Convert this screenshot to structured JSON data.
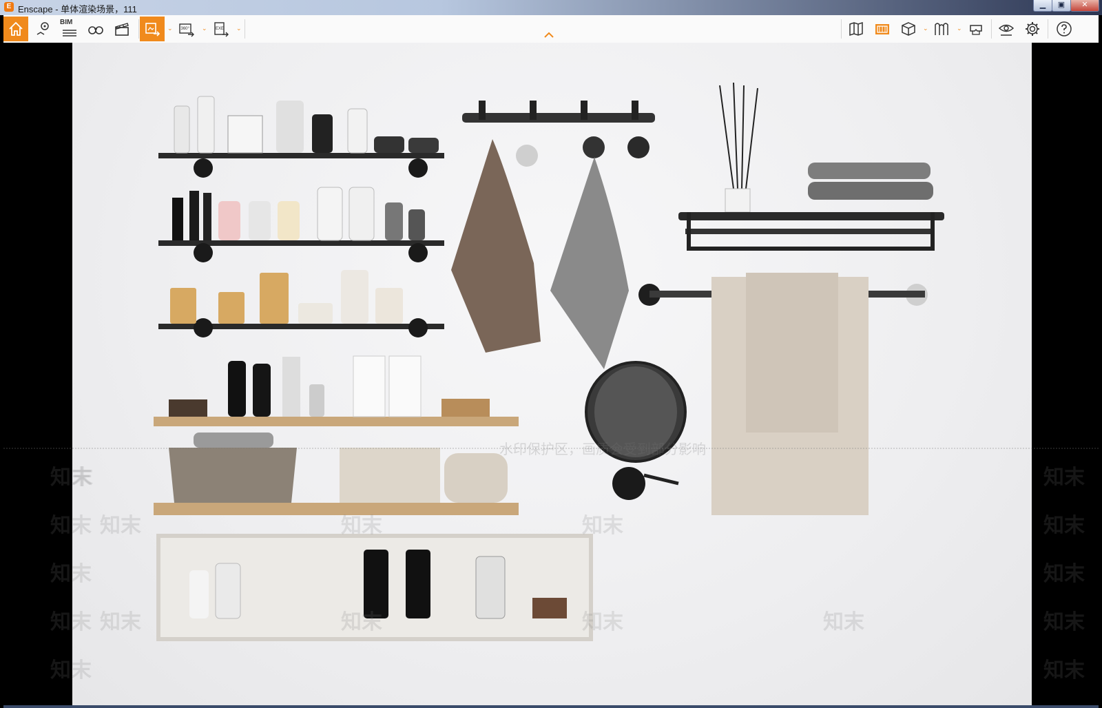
{
  "window": {
    "app_logo_text": "E",
    "title": "Enscape - 单体渲染场景，111",
    "minimize_glyph": "▁",
    "maximize_glyph": "▣",
    "close_glyph": "✕"
  },
  "toolbar": {
    "bim_label": "BIM",
    "panorama_label": "360°",
    "exe_label": "EXE",
    "caret_glyph": "⌄",
    "accent_color": "#f08a1c",
    "left_icons": [
      "home-icon",
      "map-pin-icon",
      "bim-icon",
      "binoculars-icon",
      "clapper-icon",
      "render-screenshot-icon",
      "panorama-360-icon",
      "export-exe-icon"
    ],
    "right_icons": [
      "map-icon",
      "asset-library-icon",
      "cube-icon",
      "atmosphere-icon",
      "vr-headset-icon",
      "eye-visual-settings-icon",
      "gear-icon",
      "help-icon"
    ]
  },
  "watermark": {
    "brand": "知末",
    "notice": "水印保护区，画质会受到部分影响"
  }
}
